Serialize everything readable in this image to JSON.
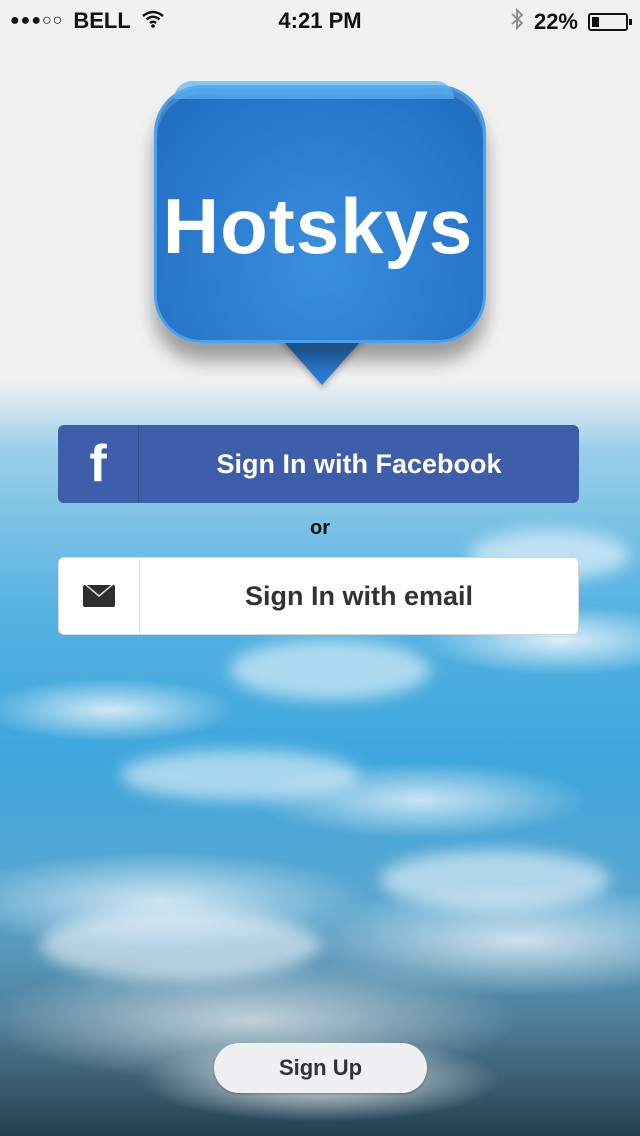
{
  "status_bar": {
    "signal": "●●●○○",
    "carrier": "BELL",
    "wifi_icon": "wifi-icon",
    "time": "4:21 PM",
    "bluetooth_icon": "bluetooth-icon",
    "battery_percent": "22%",
    "battery_level": 0.22
  },
  "logo": {
    "text": "Hotskys"
  },
  "login": {
    "facebook_icon": "f",
    "facebook_label": "Sign In with Facebook",
    "or_label": "or",
    "email_icon": "mail-icon",
    "email_label": "Sign In with email"
  },
  "footer": {
    "signup_label": "Sign Up"
  },
  "colors": {
    "facebook_blue": "#3f5ea9",
    "logo_blue": "#2a7bcf"
  }
}
